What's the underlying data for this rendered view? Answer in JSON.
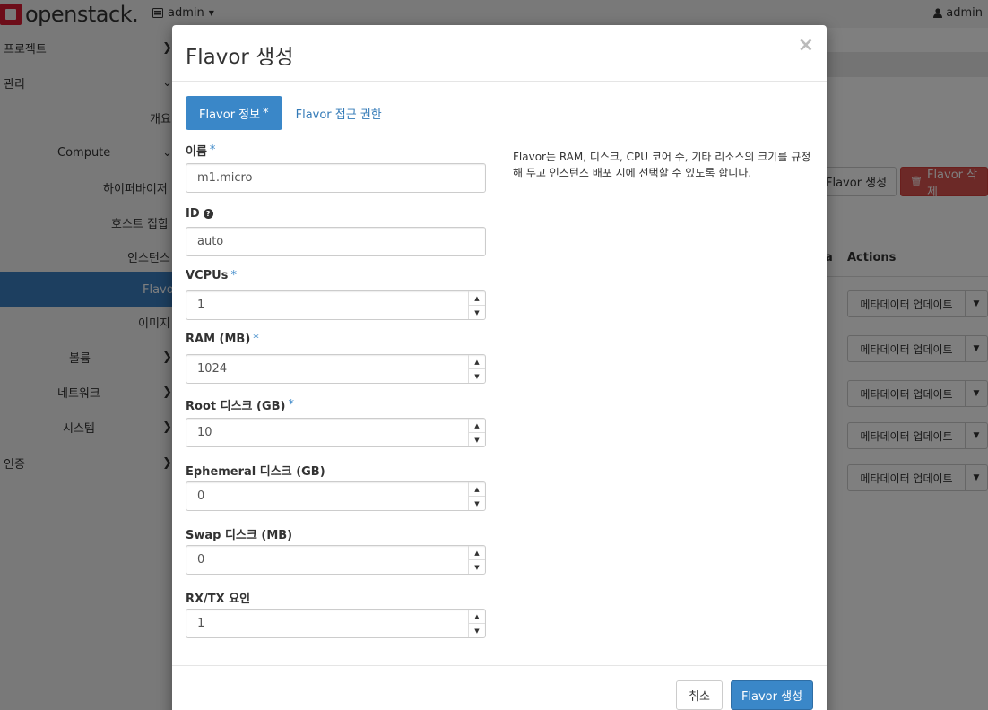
{
  "topbar": {
    "logo_text": "openstack.",
    "project_label": "admin",
    "user_label": "admin"
  },
  "sidebar": {
    "items": [
      {
        "label": "프로젝트"
      },
      {
        "label": "관리"
      },
      {
        "label": "개요"
      },
      {
        "label": "Compute"
      },
      {
        "label": "하이퍼바이저"
      },
      {
        "label": "호스트 집합"
      },
      {
        "label": "인스턴스"
      },
      {
        "label": "Flavor"
      },
      {
        "label": "이미지"
      },
      {
        "label": "볼륨"
      },
      {
        "label": "네트워크"
      },
      {
        "label": "시스템"
      },
      {
        "label": "인증"
      }
    ]
  },
  "background": {
    "create_button": "Flavor 생성",
    "delete_button": "Flavor 삭제",
    "col_partial": "a",
    "col_actions": "Actions",
    "row_action": "메타데이터 업데이트"
  },
  "modal": {
    "title": "Flavor 생성",
    "close_glyph": "×",
    "tabs": [
      {
        "label": "Flavor 정보",
        "required": "*"
      },
      {
        "label": "Flavor 접근 권한"
      }
    ],
    "description": "Flavor는 RAM, 디스크, CPU 코어 수, 기타 리소스의 크기를 규정해 두고 인스턴스 배포 시에 선택할 수 있도록 합니다.",
    "fields": {
      "name": {
        "label": "이름",
        "required": "*",
        "value": "m1.micro"
      },
      "id": {
        "label": "ID",
        "value": "auto"
      },
      "vcpus": {
        "label": "VCPUs",
        "required": "*",
        "value": "1"
      },
      "ram": {
        "label": "RAM (MB)",
        "required": "*",
        "value": "1024"
      },
      "root_disk": {
        "label": "Root 디스크 (GB)",
        "required": "*",
        "value": "10"
      },
      "ephemeral": {
        "label": "Ephemeral 디스크 (GB)",
        "value": "0"
      },
      "swap": {
        "label": "Swap 디스크 (MB)",
        "value": "0"
      },
      "rxtx": {
        "label": "RX/TX 요인",
        "value": "1"
      }
    },
    "footer": {
      "cancel": "취소",
      "submit": "Flavor 생성"
    }
  }
}
